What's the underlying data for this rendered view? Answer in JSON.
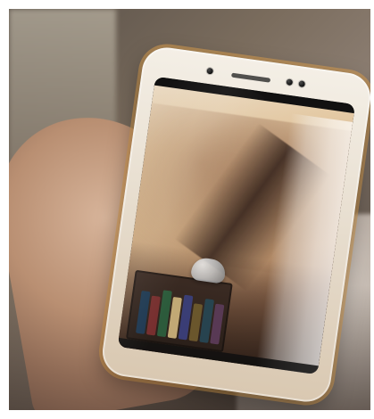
{
  "scene": {
    "type": "photo",
    "subject": "hand-holding-smartphone"
  },
  "colors": {
    "background": "#ffffff",
    "phone_frame": "#e9e0d2",
    "phone_edge_accent": "#dca050"
  },
  "icons": {
    "camera": "camera-icon",
    "speaker": "speaker-grille-icon"
  }
}
